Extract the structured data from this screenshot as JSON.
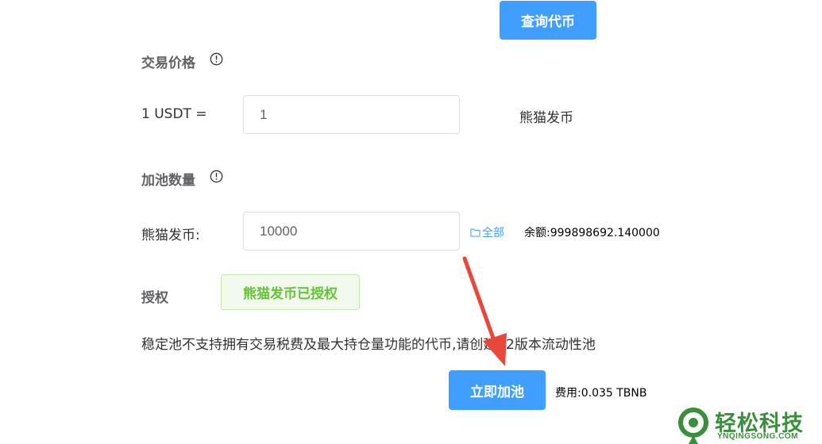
{
  "actions": {
    "query_token_label": "查询代币",
    "add_liquidity_label": "立即加池"
  },
  "price_section": {
    "title": "交易价格",
    "row_label": "1 USDT =",
    "input_value": "1",
    "token_name": "熊猫发币"
  },
  "amount_section": {
    "title": "加池数量",
    "row_label": "熊猫发币:",
    "input_value": "10000",
    "all_link_label": "全部",
    "balance_text": "余额:999898692.140000"
  },
  "authorization": {
    "label": "授权",
    "status_button_label": "熊猫发币已授权"
  },
  "notice_text": "稳定池不支持拥有交易税费及最大持仓量功能的代币,请创建V2版本流动性池",
  "fee_text": "费用:0.035 TBNB",
  "watermark": {
    "title": "轻松科技",
    "subtitle": "YNQINGSONG.COM"
  },
  "colors": {
    "primary": "#409eff",
    "success": "#67c23a",
    "arrow": "#e8473c"
  }
}
